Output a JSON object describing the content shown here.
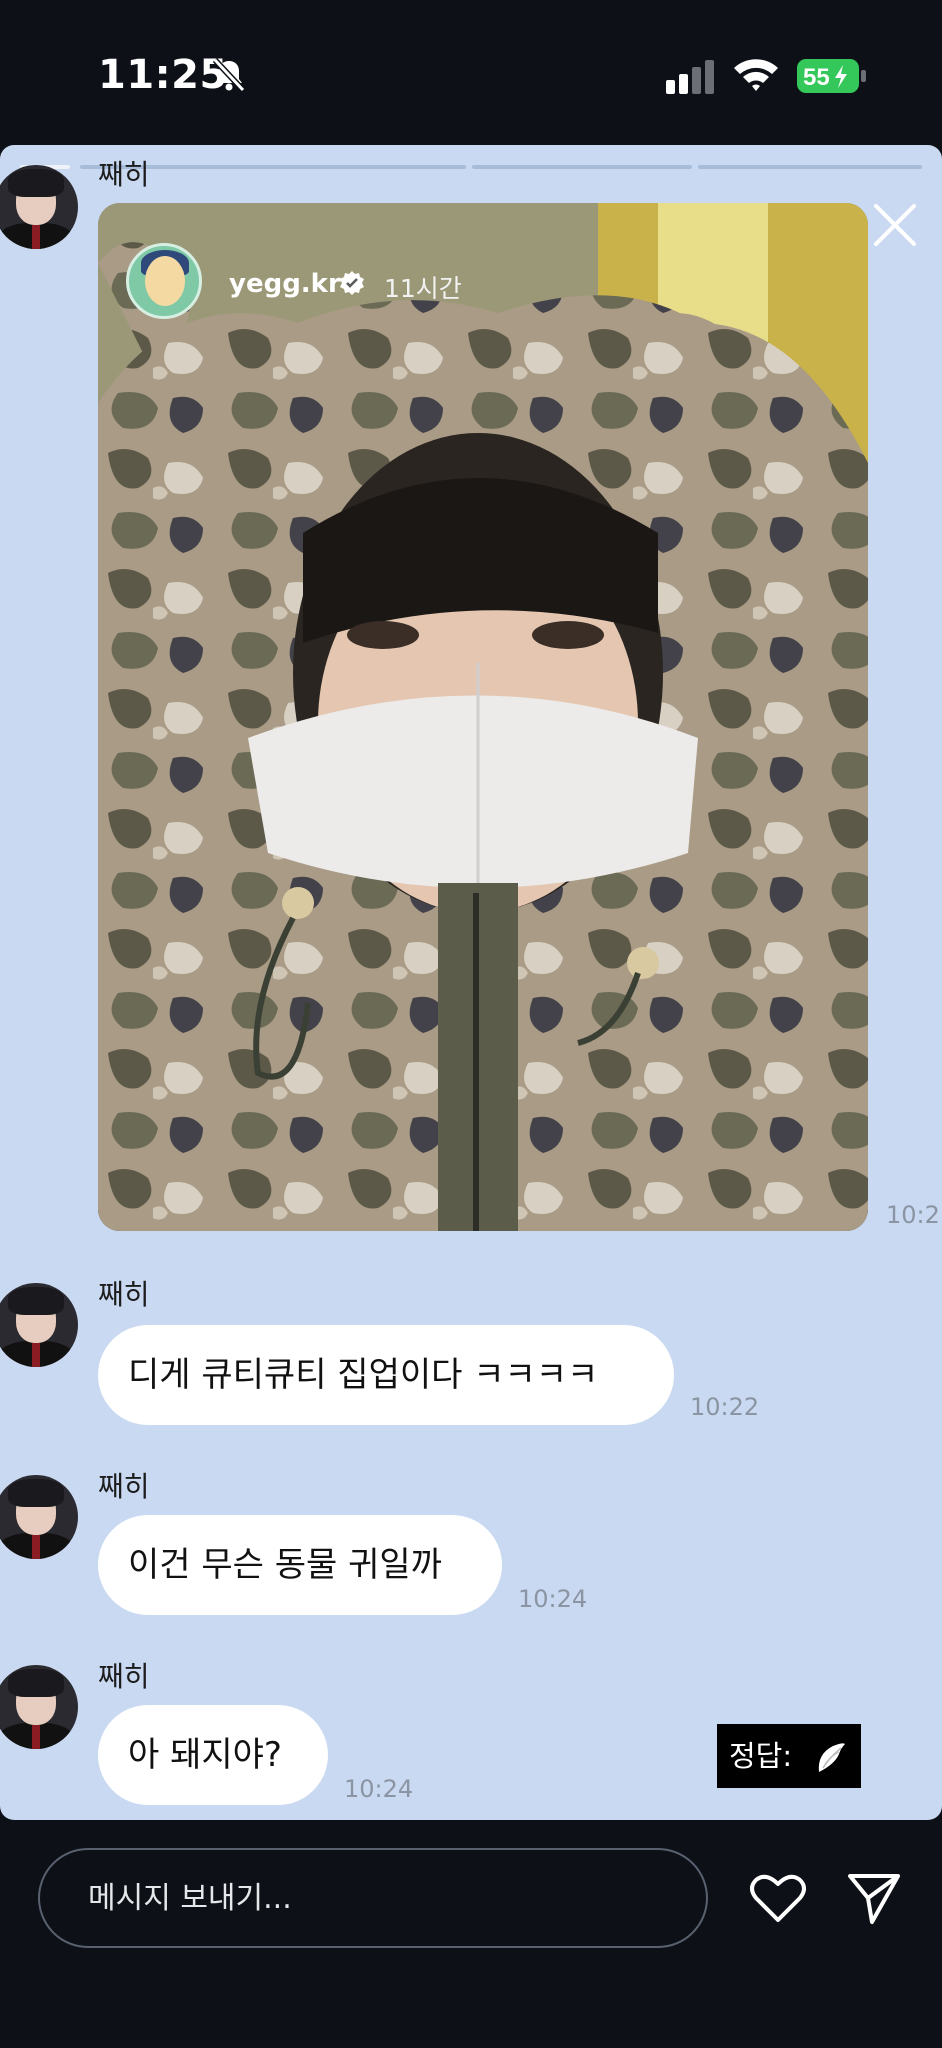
{
  "status_bar": {
    "time": "11:25",
    "battery": "55",
    "icons": [
      "bell-slash-icon",
      "cellular-signal-icon",
      "wifi-icon",
      "battery-charging-icon"
    ]
  },
  "story": {
    "progress_segments": 4,
    "active_segment": 1,
    "owner": "yegg.kr",
    "age": "11시간",
    "verified": true
  },
  "messages": [
    {
      "sender": "째히",
      "type": "story-reply",
      "time": "10:2"
    },
    {
      "sender": "째히",
      "text": "디게 큐티큐티 집업이다 ㅋㅋㅋㅋ",
      "time": "10:22"
    },
    {
      "sender": "째히",
      "text": "이건 무슨 동물 귀일까",
      "time": "10:24"
    },
    {
      "sender": "째히",
      "text": "아 돼지야?",
      "time": "10:24"
    }
  ],
  "overlay": {
    "answer_label": "정답:"
  },
  "composer": {
    "placeholder": "메시지 보내기..."
  },
  "colors": {
    "background": "#0d1117",
    "card": "#c9d9f1",
    "bubble": "#ffffff",
    "timestamp": "#8a94a2",
    "verified": "#ffffff"
  }
}
